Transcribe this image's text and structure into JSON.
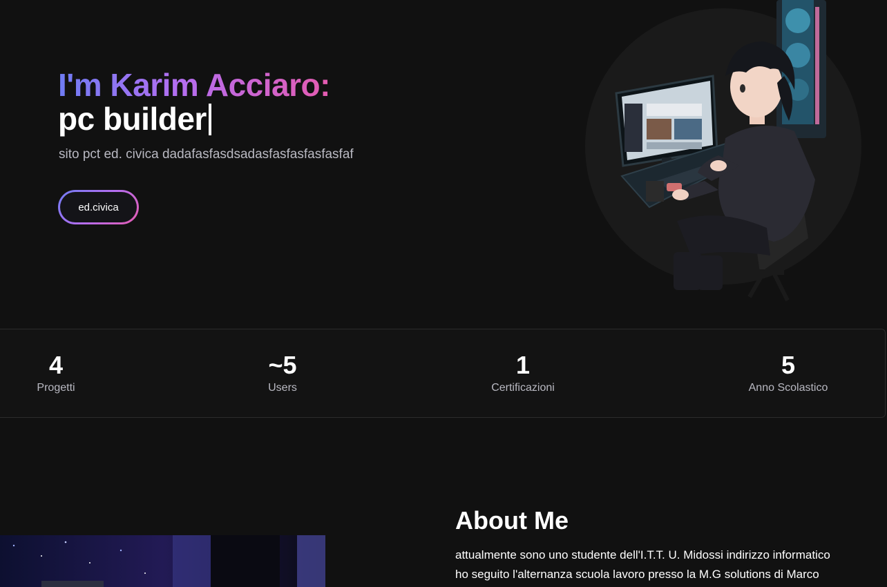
{
  "hero": {
    "title_line1": "I'm Karim Acciaro:",
    "title_line2": "pc builder",
    "subtitle": "sito pct ed. civica dadafasfasdsadasfasfasfasfasfaf",
    "button_label": "ed.civica"
  },
  "stats": [
    {
      "value": "4",
      "label": "Progetti"
    },
    {
      "value": "~5",
      "label": "Users"
    },
    {
      "value": "1",
      "label": "Certificazioni"
    },
    {
      "value": "5",
      "label": "Anno Scolastico"
    }
  ],
  "about": {
    "title": "About Me",
    "line1": "attualmente sono uno studente dell'I.T.T. U. Midossi indirizzo informatico",
    "line2": "ho seguito l'alternanza scuola lavoro presso la M.G solutions di Marco"
  },
  "colors": {
    "background": "#111111",
    "accent_start": "#6f7cf4",
    "accent_mid": "#b46ef0",
    "accent_end": "#e55bb0"
  }
}
